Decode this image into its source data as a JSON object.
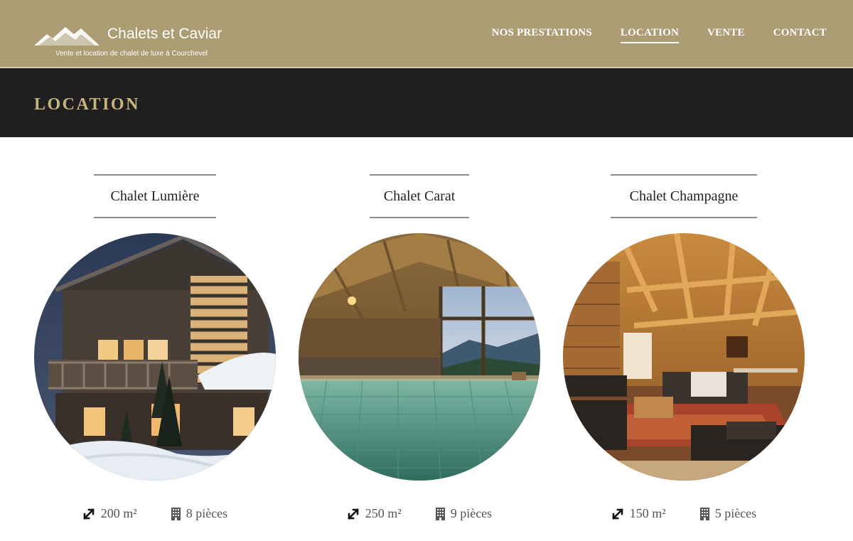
{
  "header": {
    "brand": "Chalets et Caviar",
    "tagline": "Vente et location de chalet de luxe à Courchevel",
    "nav": [
      {
        "label": "NOS PRESTATIONS",
        "active": false
      },
      {
        "label": "LOCATION",
        "active": true
      },
      {
        "label": "VENTE",
        "active": false
      },
      {
        "label": "CONTACT",
        "active": false
      }
    ]
  },
  "page": {
    "title": "LOCATION"
  },
  "chalets": [
    {
      "name": "Chalet Lumière",
      "area": "200 m²",
      "rooms": "8 pièces"
    },
    {
      "name": "Chalet Carat",
      "area": "250 m²",
      "rooms": "9 pièces"
    },
    {
      "name": "Chalet Champagne",
      "area": "150 m²",
      "rooms": "5 pièces"
    }
  ],
  "icons": {
    "logo": "mountain-logo-icon",
    "area": "resize-arrow-icon",
    "rooms": "building-icon"
  },
  "colors": {
    "header_bg": "#ac9c74",
    "banner_bg": "#1f1f1f",
    "banner_title": "#c8b57e"
  }
}
